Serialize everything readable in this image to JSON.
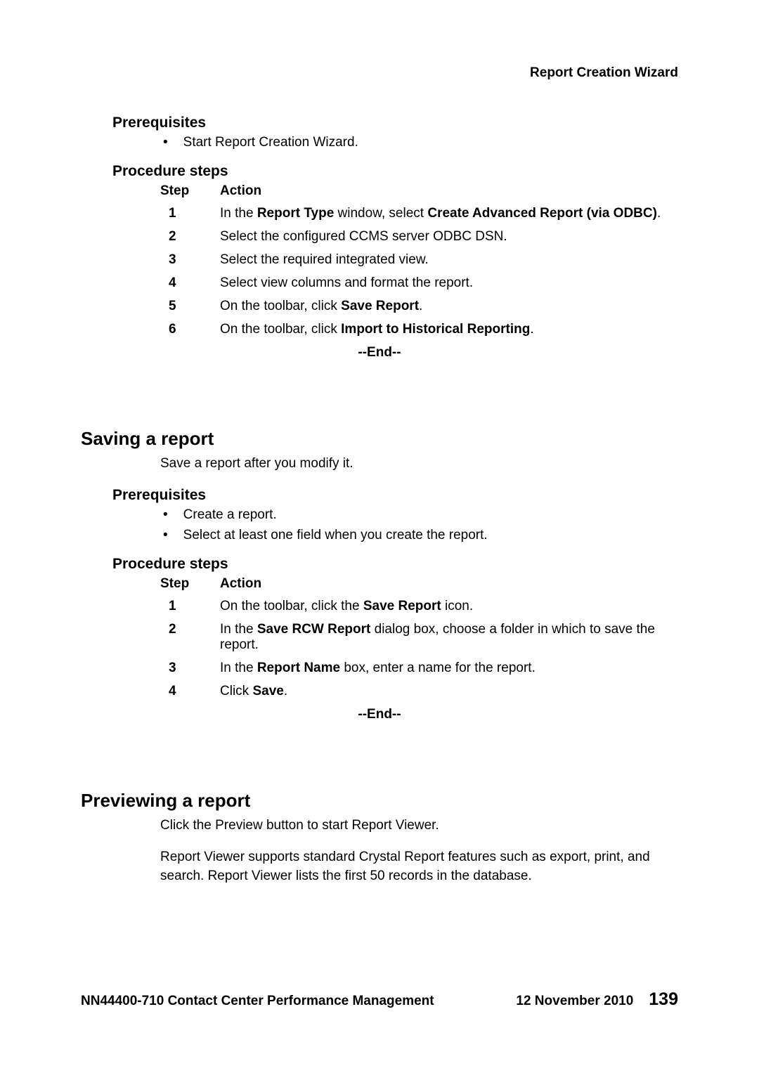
{
  "header": {
    "right_title": "Report Creation Wizard"
  },
  "section1": {
    "prereq_heading": "Prerequisites",
    "prereq_items": [
      "Start Report Creation Wizard."
    ],
    "proc_heading": "Procedure steps",
    "step_label": "Step",
    "action_label": "Action",
    "steps": [
      {
        "n": "1",
        "parts": [
          {
            "t": "In the "
          },
          {
            "t": "Report Type",
            "b": true
          },
          {
            "t": " window, select "
          },
          {
            "t": "Create Advanced Report (via ODBC)",
            "b": true
          },
          {
            "t": "."
          }
        ]
      },
      {
        "n": "2",
        "parts": [
          {
            "t": "Select the configured CCMS server ODBC DSN."
          }
        ]
      },
      {
        "n": "3",
        "parts": [
          {
            "t": "Select the required integrated view."
          }
        ]
      },
      {
        "n": "4",
        "parts": [
          {
            "t": "Select view columns and format the report."
          }
        ]
      },
      {
        "n": "5",
        "parts": [
          {
            "t": "On the toolbar, click "
          },
          {
            "t": "Save Report",
            "b": true
          },
          {
            "t": "."
          }
        ]
      },
      {
        "n": "6",
        "parts": [
          {
            "t": "On the toolbar, click "
          },
          {
            "t": "Import to Historical Reporting",
            "b": true
          },
          {
            "t": "."
          }
        ]
      }
    ],
    "end_marker": "--End--"
  },
  "section2": {
    "heading": "Saving a report",
    "intro": "Save a report after you modify it.",
    "prereq_heading": "Prerequisites",
    "prereq_items": [
      "Create a report.",
      "Select at least one field when you create the report."
    ],
    "proc_heading": "Procedure steps",
    "step_label": "Step",
    "action_label": "Action",
    "steps": [
      {
        "n": "1",
        "parts": [
          {
            "t": "On the toolbar, click the "
          },
          {
            "t": "Save Report",
            "b": true
          },
          {
            "t": " icon."
          }
        ]
      },
      {
        "n": "2",
        "parts": [
          {
            "t": "In the "
          },
          {
            "t": "Save RCW Report",
            "b": true
          },
          {
            "t": " dialog box, choose a folder in which to save the report."
          }
        ]
      },
      {
        "n": "3",
        "parts": [
          {
            "t": "In the "
          },
          {
            "t": "Report Name",
            "b": true
          },
          {
            "t": " box, enter a name for the report."
          }
        ]
      },
      {
        "n": "4",
        "parts": [
          {
            "t": "Click "
          },
          {
            "t": "Save",
            "b": true
          },
          {
            "t": "."
          }
        ]
      }
    ],
    "end_marker": "--End--"
  },
  "section3": {
    "heading": "Previewing a report",
    "intro": "Click the Preview button to start Report Viewer.",
    "body": "Report Viewer supports standard Crystal Report features such as export, print, and search. Report Viewer lists the first 50 records in the database."
  },
  "footer": {
    "left": "NN44400-710 Contact Center Performance Management",
    "date": "12 November 2010",
    "page": "139"
  }
}
